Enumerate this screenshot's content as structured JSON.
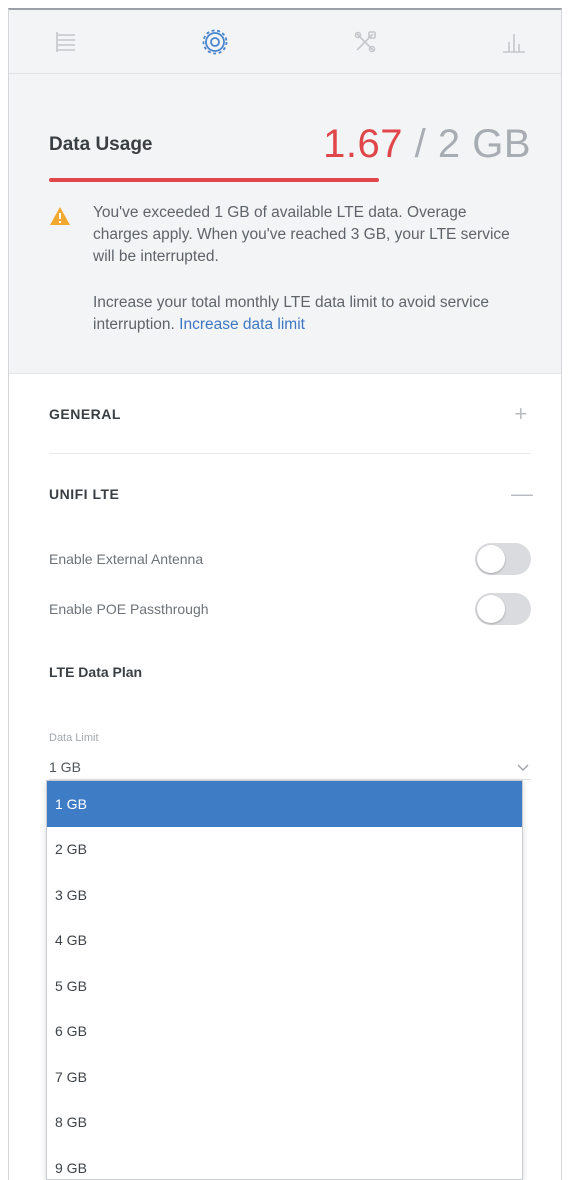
{
  "nav": {
    "items": [
      {
        "name": "list-icon",
        "active": false
      },
      {
        "name": "settings-icon",
        "active": true
      },
      {
        "name": "tools-icon",
        "active": false
      },
      {
        "name": "stats-icon",
        "active": false
      }
    ]
  },
  "usage": {
    "title": "Data Usage",
    "used": "1.67",
    "separator": " / ",
    "limit": "2 GB",
    "used_fraction": 0.835,
    "bar_color": "#e0464a",
    "warning_text": "You've exceeded 1 GB of available LTE data. Overage charges apply. When you've reached 3 GB, your LTE service will be interrupted.",
    "advice_text": "Increase your total monthly LTE data limit to avoid service interruption.",
    "advice_link": "Increase data limit"
  },
  "sections": {
    "general": {
      "label": "GENERAL",
      "sign": "+"
    },
    "lte": {
      "label": "UNIFI LTE",
      "sign": "—"
    }
  },
  "toggles": [
    {
      "label": "Enable External Antenna",
      "on": false
    },
    {
      "label": "Enable POE Passthrough",
      "on": false
    }
  ],
  "plan": {
    "title": "LTE Data Plan",
    "field_label": "Data Limit",
    "value": "1 GB"
  },
  "dropdown": {
    "options": [
      "1 GB",
      "2 GB",
      "3 GB",
      "4 GB",
      "5 GB",
      "6 GB",
      "7 GB",
      "8 GB",
      "9 GB"
    ],
    "selected_index": 0
  },
  "colors": {
    "accent": "#3f7cc6",
    "danger": "#e0464a",
    "warning": "#f0a830"
  }
}
